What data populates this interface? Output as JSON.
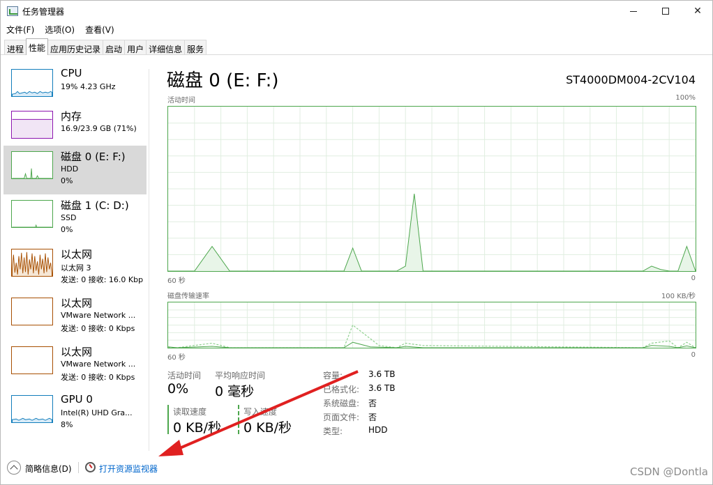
{
  "window": {
    "title": "任务管理器"
  },
  "menu": [
    "文件(F)",
    "选项(O)",
    "查看(V)"
  ],
  "tabs": [
    "进程",
    "性能",
    "应用历史记录",
    "启动",
    "用户",
    "详细信息",
    "服务"
  ],
  "sidebar": {
    "items": [
      {
        "name": "CPU",
        "line1": "19%  4.23 GHz",
        "line2": ""
      },
      {
        "name": "内存",
        "line1": "16.9/23.9 GB (71%)",
        "line2": ""
      },
      {
        "name": "磁盘 0 (E: F:)",
        "line1": "HDD",
        "line2": "0%"
      },
      {
        "name": "磁盘 1 (C: D:)",
        "line1": "SSD",
        "line2": "0%"
      },
      {
        "name": "以太网",
        "line1": "以太网 3",
        "line2": "发送: 0 接收: 16.0 Kbp"
      },
      {
        "name": "以太网",
        "line1": "VMware Network ...",
        "line2": "发送: 0 接收: 0 Kbps"
      },
      {
        "name": "以太网",
        "line1": "VMware Network ...",
        "line2": "发送: 0 接收: 0 Kbps"
      },
      {
        "name": "GPU 0",
        "line1": "Intel(R) UHD Gra...",
        "line2": "8%"
      }
    ]
  },
  "main": {
    "title": "磁盘 0 (E: F:)",
    "model": "ST4000DM004-2CV104",
    "activity_chart": {
      "label": "活动时间",
      "max": "100%",
      "xleft": "60 秒",
      "xright": "0"
    },
    "transfer_chart": {
      "label": "磁盘传输速率",
      "max": "100 KB/秒",
      "xleft": "60 秒",
      "xright": "0"
    },
    "stats": {
      "active_label": "活动时间",
      "active_value": "0%",
      "resp_label": "平均响应时间",
      "resp_value": "0 毫秒",
      "read_label": "读取速度",
      "read_value": "0 KB/秒",
      "write_label": "写入速度",
      "write_value": "0 KB/秒"
    },
    "props": [
      {
        "k": "容量:",
        "v": "3.6 TB"
      },
      {
        "k": "已格式化:",
        "v": "3.6 TB"
      },
      {
        "k": "系统磁盘:",
        "v": "否"
      },
      {
        "k": "页面文件:",
        "v": "否"
      },
      {
        "k": "类型:",
        "v": "HDD"
      }
    ]
  },
  "bottom": {
    "brief": "简略信息(D)",
    "open_monitor": "打开资源监视器",
    "watermark": "CSDN @Dontla"
  },
  "colors": {
    "disk": "#4ca64c",
    "cpu": "#117dbb",
    "memory": "#8b12ae",
    "net": "#a74f01",
    "selected": "#d9d9d9"
  },
  "chart_data": [
    {
      "type": "area",
      "title": "活动时间",
      "x": [
        60,
        55,
        50,
        45,
        40,
        35,
        30,
        25,
        20,
        15,
        10,
        5,
        0
      ],
      "ylim": [
        0,
        100
      ],
      "unit": "%",
      "points": [
        [
          60,
          0
        ],
        [
          57,
          0
        ],
        [
          55,
          15
        ],
        [
          53,
          0
        ],
        [
          40,
          0
        ],
        [
          39,
          14
        ],
        [
          38,
          0
        ],
        [
          34,
          0
        ],
        [
          33,
          3
        ],
        [
          32,
          47
        ],
        [
          31,
          0
        ],
        [
          6,
          0
        ],
        [
          5,
          3
        ],
        [
          4,
          1
        ],
        [
          3,
          0
        ],
        [
          2,
          0
        ],
        [
          1,
          15
        ],
        [
          0,
          0
        ]
      ]
    },
    {
      "type": "line",
      "title": "磁盘传输速率",
      "ylim": [
        0,
        100
      ],
      "unit": "KB/秒",
      "read_points": [
        [
          60,
          0
        ],
        [
          59,
          0
        ],
        [
          55,
          10
        ],
        [
          53,
          0
        ],
        [
          40,
          0
        ],
        [
          39,
          50
        ],
        [
          37,
          20
        ],
        [
          36,
          5
        ],
        [
          34,
          0
        ],
        [
          33,
          10
        ],
        [
          31,
          5
        ],
        [
          6,
          0
        ],
        [
          5,
          10
        ],
        [
          3,
          15
        ],
        [
          2,
          0
        ],
        [
          1,
          12
        ],
        [
          0,
          0
        ]
      ],
      "write_points": [
        [
          60,
          2
        ],
        [
          59,
          0
        ],
        [
          55,
          3
        ],
        [
          53,
          0
        ],
        [
          40,
          0
        ],
        [
          39,
          12
        ],
        [
          37,
          2
        ],
        [
          34,
          0
        ],
        [
          33,
          3
        ],
        [
          31,
          0
        ],
        [
          6,
          0
        ],
        [
          5,
          5
        ],
        [
          3,
          3
        ],
        [
          2,
          0
        ],
        [
          1,
          4
        ],
        [
          0,
          0
        ]
      ]
    }
  ]
}
